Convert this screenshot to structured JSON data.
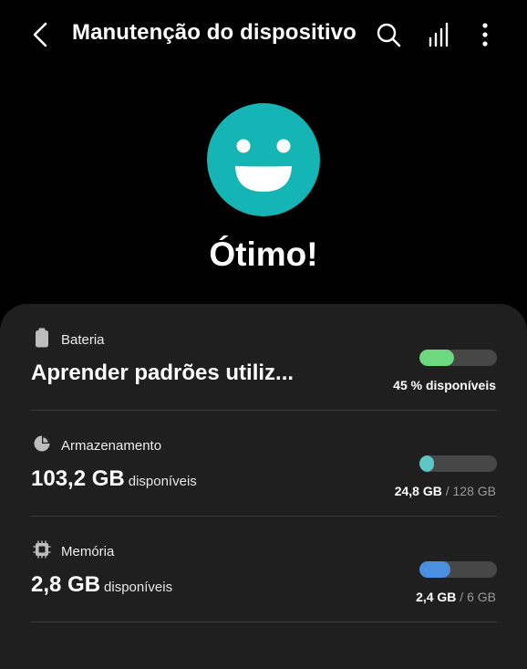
{
  "header": {
    "title": "Manutenção do dispositivo",
    "icons": [
      "back-arrow-icon",
      "search-icon",
      "signal-bars-icon",
      "more-options-icon"
    ]
  },
  "hero": {
    "icon": "smiley-face-icon",
    "color": "#16b5b5",
    "status": "Ótimo!"
  },
  "items": [
    {
      "label": "Bateria",
      "icon": "battery-icon",
      "value": "Aprender padrões utiliz...",
      "value_suffix": "",
      "bar_fraction": 0.45,
      "bar_color": "#6dd97f",
      "caption_primary": "45 % disponíveis",
      "caption_secondary": ""
    },
    {
      "label": "Armazenamento",
      "icon": "storage-pie-icon",
      "value": "103,2 GB",
      "value_suffix": "disponíveis",
      "bar_fraction": 0.19,
      "bar_color": "#5ec6c6",
      "caption_primary": "24,8 GB",
      "caption_secondary": " / 128 GB"
    },
    {
      "label": "Memória",
      "icon": "memory-chip-icon",
      "value": "2,8 GB",
      "value_suffix": "disponíveis",
      "bar_fraction": 0.4,
      "bar_color": "#4a8fe0",
      "caption_primary": "2,4 GB",
      "caption_secondary": " / 6 GB"
    }
  ]
}
